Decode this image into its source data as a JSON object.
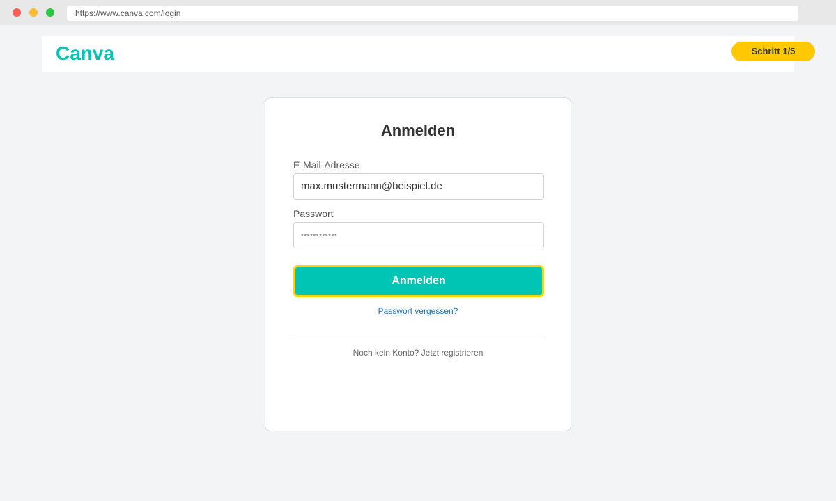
{
  "browser": {
    "url": "https://www.canva.com/login"
  },
  "header": {
    "logo": "Canva",
    "step_badge": "Schritt 1/5"
  },
  "login_form": {
    "title": "Anmelden",
    "email_label": "E-Mail-Adresse",
    "email_value": "max.mustermann@beispiel.de",
    "password_label": "Passwort",
    "password_value": "••••••••••••",
    "submit_label": "Anmelden",
    "forgot_link": "Passwort vergessen?",
    "register_text": "Noch kein Konto? Jetzt registrieren"
  },
  "colors": {
    "brand": "#00c4b4",
    "highlight": "#ffd400",
    "badge": "#ffc800",
    "link": "#1a73c8"
  }
}
